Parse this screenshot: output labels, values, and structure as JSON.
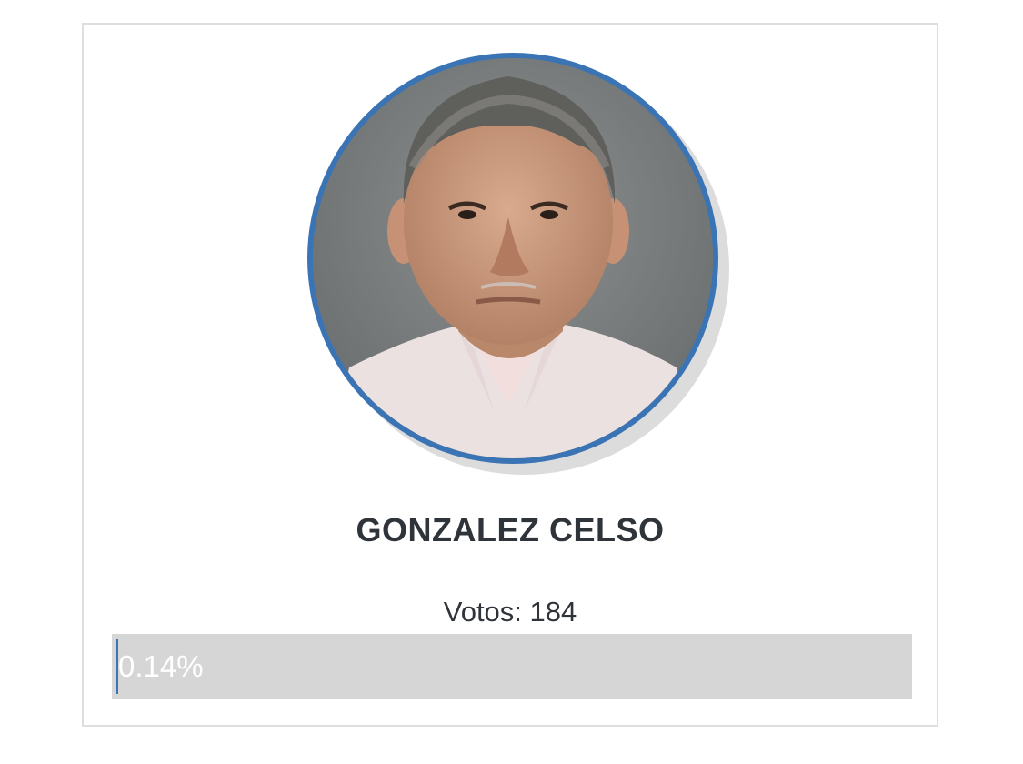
{
  "candidate": {
    "name": "GONZALEZ CELSO",
    "photo_icon": "candidate-portrait",
    "votes_label": "Votos: 184",
    "percent_label": "0.14%",
    "percent_value": 0.14
  },
  "colors": {
    "accent": "#3a74b4",
    "track": "#d6d6d6",
    "text": "#2f343b",
    "border": "#dedede"
  }
}
